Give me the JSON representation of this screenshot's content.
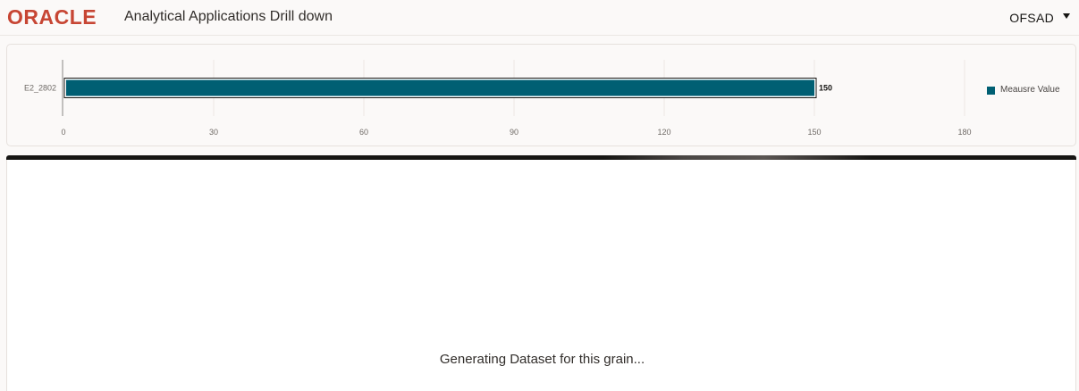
{
  "header": {
    "logo": "ORACLE",
    "title": "Analytical Applications Drill down",
    "user": "OFSAD"
  },
  "colors": {
    "brand": "#c74634",
    "bar": "#005f73"
  },
  "chart_data": {
    "type": "bar",
    "orientation": "horizontal",
    "categories": [
      "E2_2802"
    ],
    "series": [
      {
        "name": "Meausre Value",
        "values": [
          150
        ]
      }
    ],
    "data_labels": [
      "150"
    ],
    "xlim": [
      0,
      180
    ],
    "xticks": [
      0,
      30,
      60,
      90,
      120,
      150,
      180
    ],
    "grid": true,
    "legend": "right"
  },
  "status": {
    "message": "Generating Dataset for this grain..."
  }
}
